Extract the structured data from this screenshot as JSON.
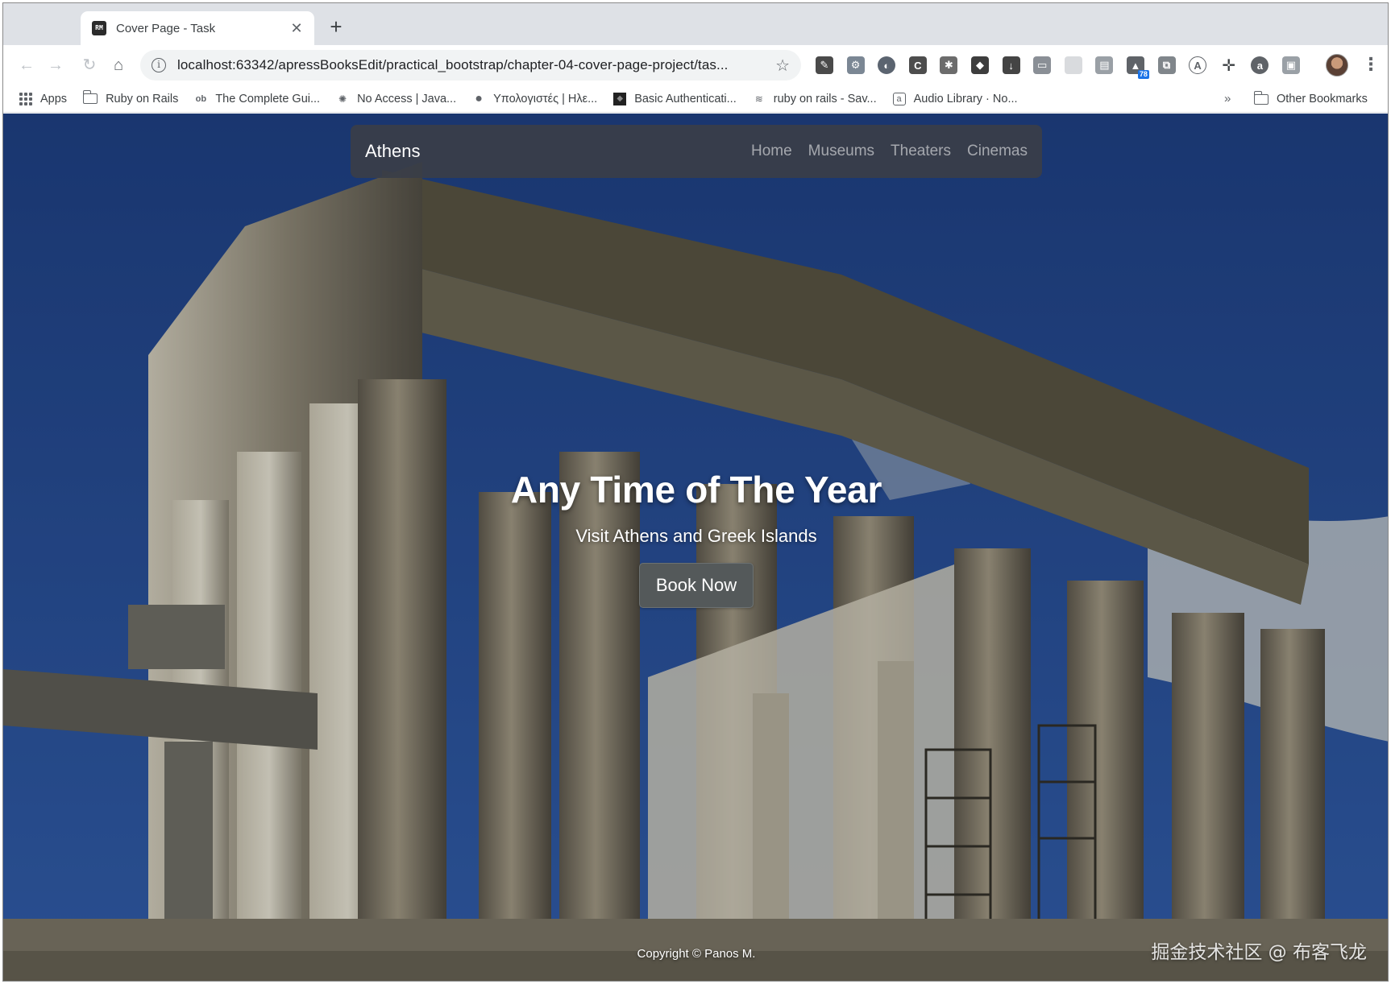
{
  "browser": {
    "tab": {
      "title": "Cover Page - Task",
      "favicon_text": "RM"
    },
    "url": "localhost:63342/apressBooksEdit/practical_bootstrap/chapter-04-cover-page-project/tas...",
    "extension_badge": "78",
    "bookmarks": [
      {
        "label": "Apps",
        "icon": "apps-grid-icon"
      },
      {
        "label": "Ruby on Rails",
        "icon": "folder-icon"
      },
      {
        "label": "The Complete Gui...",
        "icon": "ob-icon"
      },
      {
        "label": "No Access | Java...",
        "icon": "gear-icon"
      },
      {
        "label": "Υπολογιστές | Ηλε...",
        "icon": "chat-icon"
      },
      {
        "label": "Basic Authenticati...",
        "icon": "cube-icon"
      },
      {
        "label": "ruby on rails - Sav...",
        "icon": "stack-icon"
      },
      {
        "label": "Audio Library · No...",
        "icon": "audio-icon"
      }
    ],
    "bookmarks_overflow": "»",
    "other_bookmarks": "Other Bookmarks"
  },
  "page": {
    "navbar": {
      "brand": "Athens",
      "links": [
        "Home",
        "Museums",
        "Theaters",
        "Cinemas"
      ]
    },
    "hero": {
      "title": "Any Time of The Year",
      "subtitle": "Visit Athens and Greek Islands",
      "button": "Book Now"
    },
    "footer": "Copyright © Panos M.",
    "watermark": "掘金技术社区 @ 布客飞龙"
  }
}
